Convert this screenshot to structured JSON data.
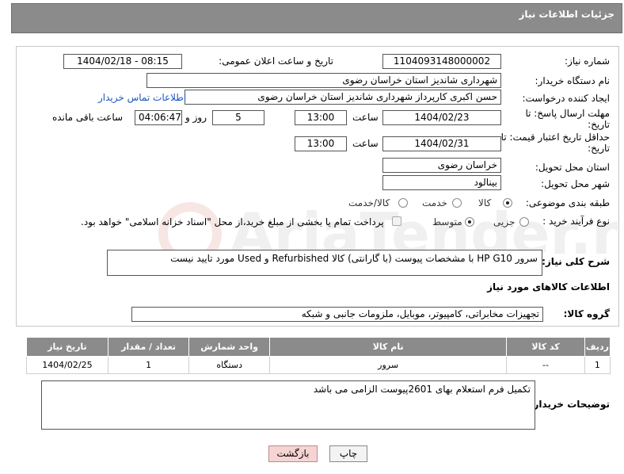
{
  "header": {
    "title": "جزئیات اطلاعات نیاز"
  },
  "fields": {
    "need_number_label": "شماره نیاز:",
    "need_number": "1104093148000002",
    "announce_label": "تاریخ و ساعت اعلان عمومی:",
    "announce_value": "1404/02/18 - 08:15",
    "buyer_org_label": "نام دستگاه خریدار:",
    "buyer_org": "شهرداری شاندیز استان خراسان رضوی",
    "creator_label": "ایجاد کننده درخواست:",
    "creator": "حسن اکبری کارپرداز شهرداری شاندیز استان خراسان رضوی",
    "contact_link": "اطلاعات تماس خریدار",
    "deadline_label": "مهلت ارسال پاسخ: تا تاریخ:",
    "deadline_date": "1404/02/23",
    "time_label": "ساعت",
    "deadline_time": "13:00",
    "days_value": "5",
    "days_label": "روز و",
    "remaining_time": "04:06:47",
    "remaining_label": "ساعت باقی مانده",
    "validity_label": "حداقل تاریخ اعتبار قیمت: تا تاریخ:",
    "validity_date": "1404/02/31",
    "validity_time": "13:00",
    "province_label": "استان محل تحویل:",
    "province": "خراسان رضوی",
    "city_label": "شهر محل تحویل:",
    "city": "بینالود",
    "category_label": "طبقه بندی موضوعی:",
    "category_options": [
      "کالا",
      "خدمت",
      "کالا/خدمت"
    ],
    "category_selected": "کالا",
    "process_label": "نوع فرآیند خرید :",
    "process_options": [
      "جزیی",
      "متوسط"
    ],
    "process_selected": "متوسط",
    "payment_note": "پرداخت تمام یا بخشی از مبلغ خرید،از محل \"اسناد خزانه اسلامی\" خواهد بود.",
    "summary_label": "شرح کلی نیاز:",
    "summary_text": "سرور HP G10 با مشخصات پیوست (با گارانتی)    کالا Refurbished و Used مورد تایید نیست",
    "goods_info_title": "اطلاعات کالاهای مورد نیاز",
    "goods_group_label": "گروه کالا:",
    "goods_group": "تجهیزات مخابراتی، کامپیوتر، موبایل، ملزومات جانبی و شبکه"
  },
  "table": {
    "headers": [
      "ردیف",
      "کد کالا",
      "نام کالا",
      "واحد شمارش",
      "تعداد / مقدار",
      "تاریخ نیاز"
    ],
    "rows": [
      [
        "1",
        "--",
        "سرور",
        "دستگاه",
        "1",
        "1404/02/25"
      ]
    ]
  },
  "buyer_notes_label": "توضیحات خریدار:",
  "buyer_notes": "تکمیل فرم استعلام بهای 2601پیوست الزامی می باشد",
  "buttons": {
    "print": "چاپ",
    "back": "بازگشت"
  },
  "watermark_text": "AriaTender.neT",
  "colors": {
    "header_bg": "#8b8b8b",
    "link": "#1a55c4",
    "back_button": "#f7d4d4"
  }
}
